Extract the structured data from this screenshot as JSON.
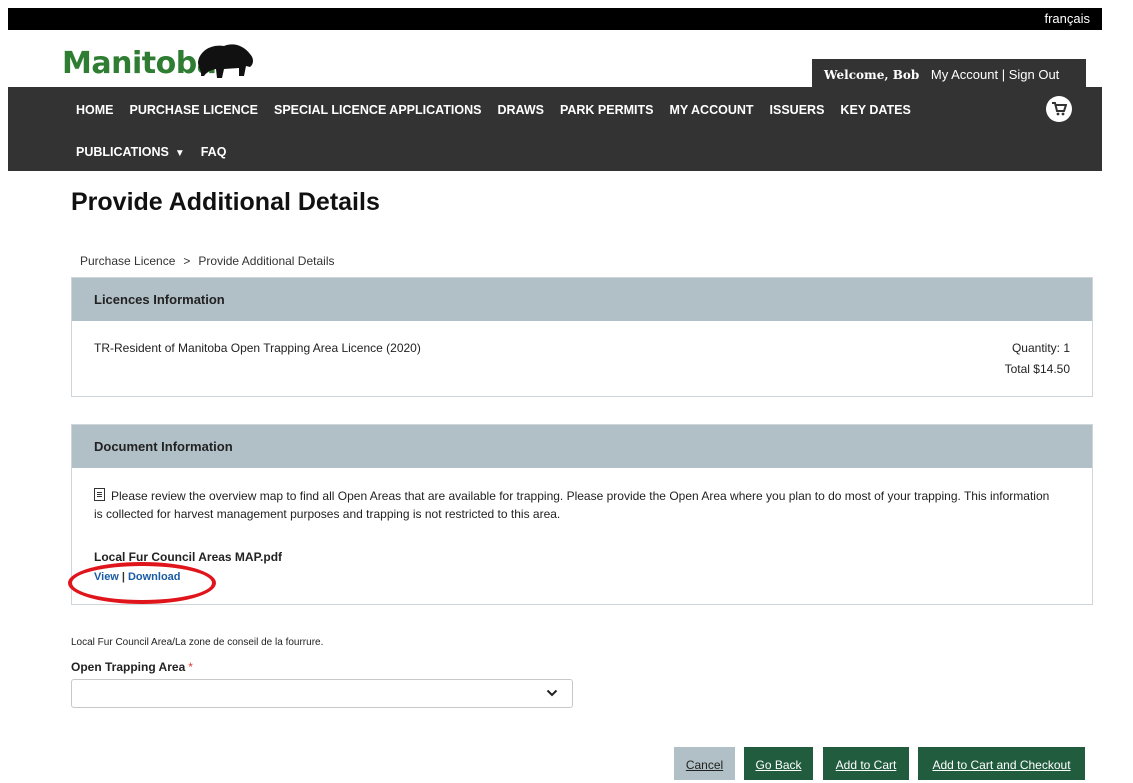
{
  "topbar": {
    "language_link": "français"
  },
  "logo": {
    "text": "Manitoba"
  },
  "account": {
    "welcome": "Welcome, Bob",
    "my_account": "My Account",
    "separator": "|",
    "sign_out": "Sign Out"
  },
  "nav": {
    "row1": [
      "HOME",
      "PURCHASE LICENCE",
      "SPECIAL LICENCE APPLICATIONS",
      "DRAWS",
      "PARK PERMITS",
      "MY ACCOUNT",
      "ISSUERS",
      "KEY DATES"
    ],
    "row2": {
      "publications": "PUBLICATIONS",
      "faq": "FAQ"
    },
    "cart_icon": "shopping-cart-icon"
  },
  "page": {
    "title": "Provide Additional Details"
  },
  "breadcrumb": {
    "parent": "Purchase Licence",
    "separator": ">",
    "current": "Provide Additional Details"
  },
  "licences": {
    "heading": "Licences Information",
    "name": "TR-Resident of Manitoba Open Trapping Area Licence (2020)",
    "quantity": "Quantity: 1",
    "total": "Total $14.50"
  },
  "document": {
    "heading": "Document Information",
    "message": "Please review the overview map to find all Open Areas that are available for trapping. Please provide the Open Area where you plan to do most of your trapping. This information is collected for harvest management purposes and trapping is not restricted to this area.",
    "file_name": "Local Fur Council Areas MAP.pdf",
    "view_label": "View",
    "link_separator": "|",
    "download_label": "Download"
  },
  "form": {
    "area_label": "Local Fur Council Area/La zone de conseil de la fourrure.",
    "field_label": "Open Trapping Area",
    "required_marker": "*",
    "selected_value": ""
  },
  "buttons": {
    "cancel": "Cancel",
    "go_back": "Go Back",
    "add_to_cart": "Add to Cart",
    "add_to_cart_checkout": "Add to Cart and Checkout"
  },
  "colors": {
    "nav_bg": "#333333",
    "panel_header": "#b1bfc6",
    "button_green": "#215c3e",
    "highlight_circle": "#e0141b"
  }
}
